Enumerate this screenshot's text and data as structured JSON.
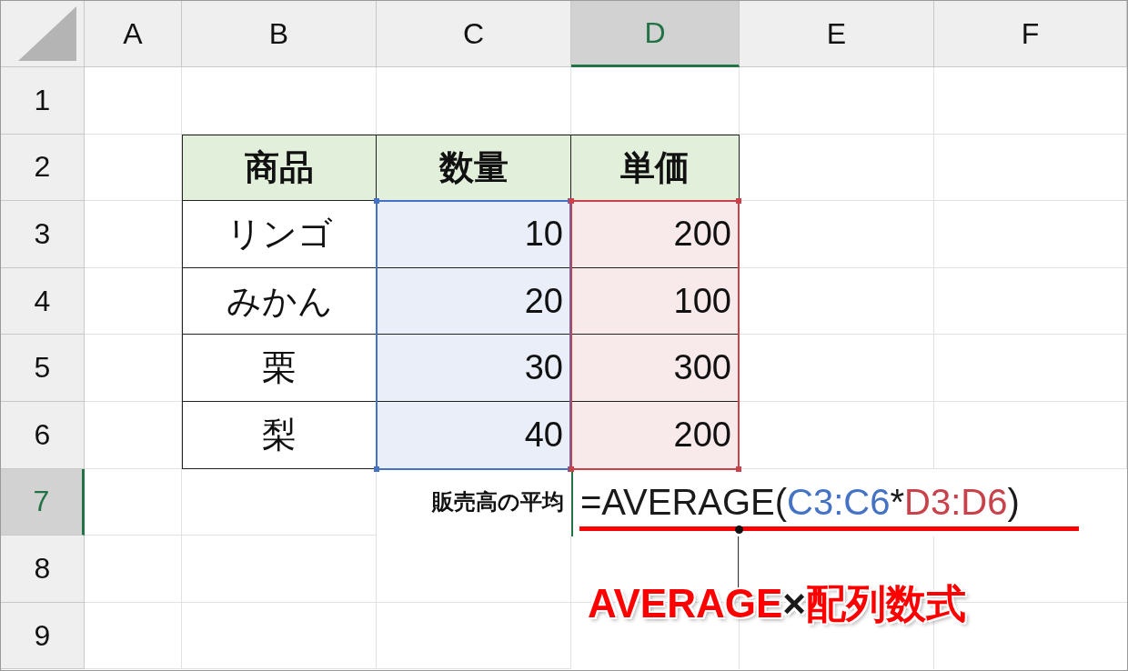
{
  "columns": [
    {
      "label": "A",
      "selected": false
    },
    {
      "label": "B",
      "selected": false
    },
    {
      "label": "C",
      "selected": false
    },
    {
      "label": "D",
      "selected": true
    },
    {
      "label": "E",
      "selected": false
    },
    {
      "label": "F",
      "selected": false
    }
  ],
  "rows": [
    {
      "label": "1",
      "selected": false
    },
    {
      "label": "2",
      "selected": false
    },
    {
      "label": "3",
      "selected": false
    },
    {
      "label": "4",
      "selected": false
    },
    {
      "label": "5",
      "selected": false
    },
    {
      "label": "6",
      "selected": false
    },
    {
      "label": "7",
      "selected": true
    },
    {
      "label": "8",
      "selected": false
    },
    {
      "label": "9",
      "selected": false
    }
  ],
  "table": {
    "headers": [
      "商品",
      "数量",
      "単価"
    ],
    "rows": [
      {
        "item": "リンゴ",
        "quantity": "10",
        "price": "200"
      },
      {
        "item": "みかん",
        "quantity": "20",
        "price": "100"
      },
      {
        "item": "栗",
        "quantity": "30",
        "price": "300"
      },
      {
        "item": "梨",
        "quantity": "40",
        "price": "200"
      }
    ]
  },
  "summary": {
    "label": "販売高の平均",
    "formula": [
      {
        "text": "=AVERAGE(",
        "color": "#1a1a1a"
      },
      {
        "text": "C3:C6",
        "color": "#4472c4"
      },
      {
        "text": "*",
        "color": "#1a1a1a"
      },
      {
        "text": "D3:D6",
        "color": "#c8414b"
      },
      {
        "text": ")",
        "color": "#1a1a1a"
      }
    ]
  },
  "annotation": [
    {
      "text": "AVERAGE",
      "color": "#ff0000"
    },
    {
      "text": "×",
      "color": "#1a1a1a"
    },
    {
      "text": "配列数式",
      "color": "#ff0000"
    }
  ]
}
